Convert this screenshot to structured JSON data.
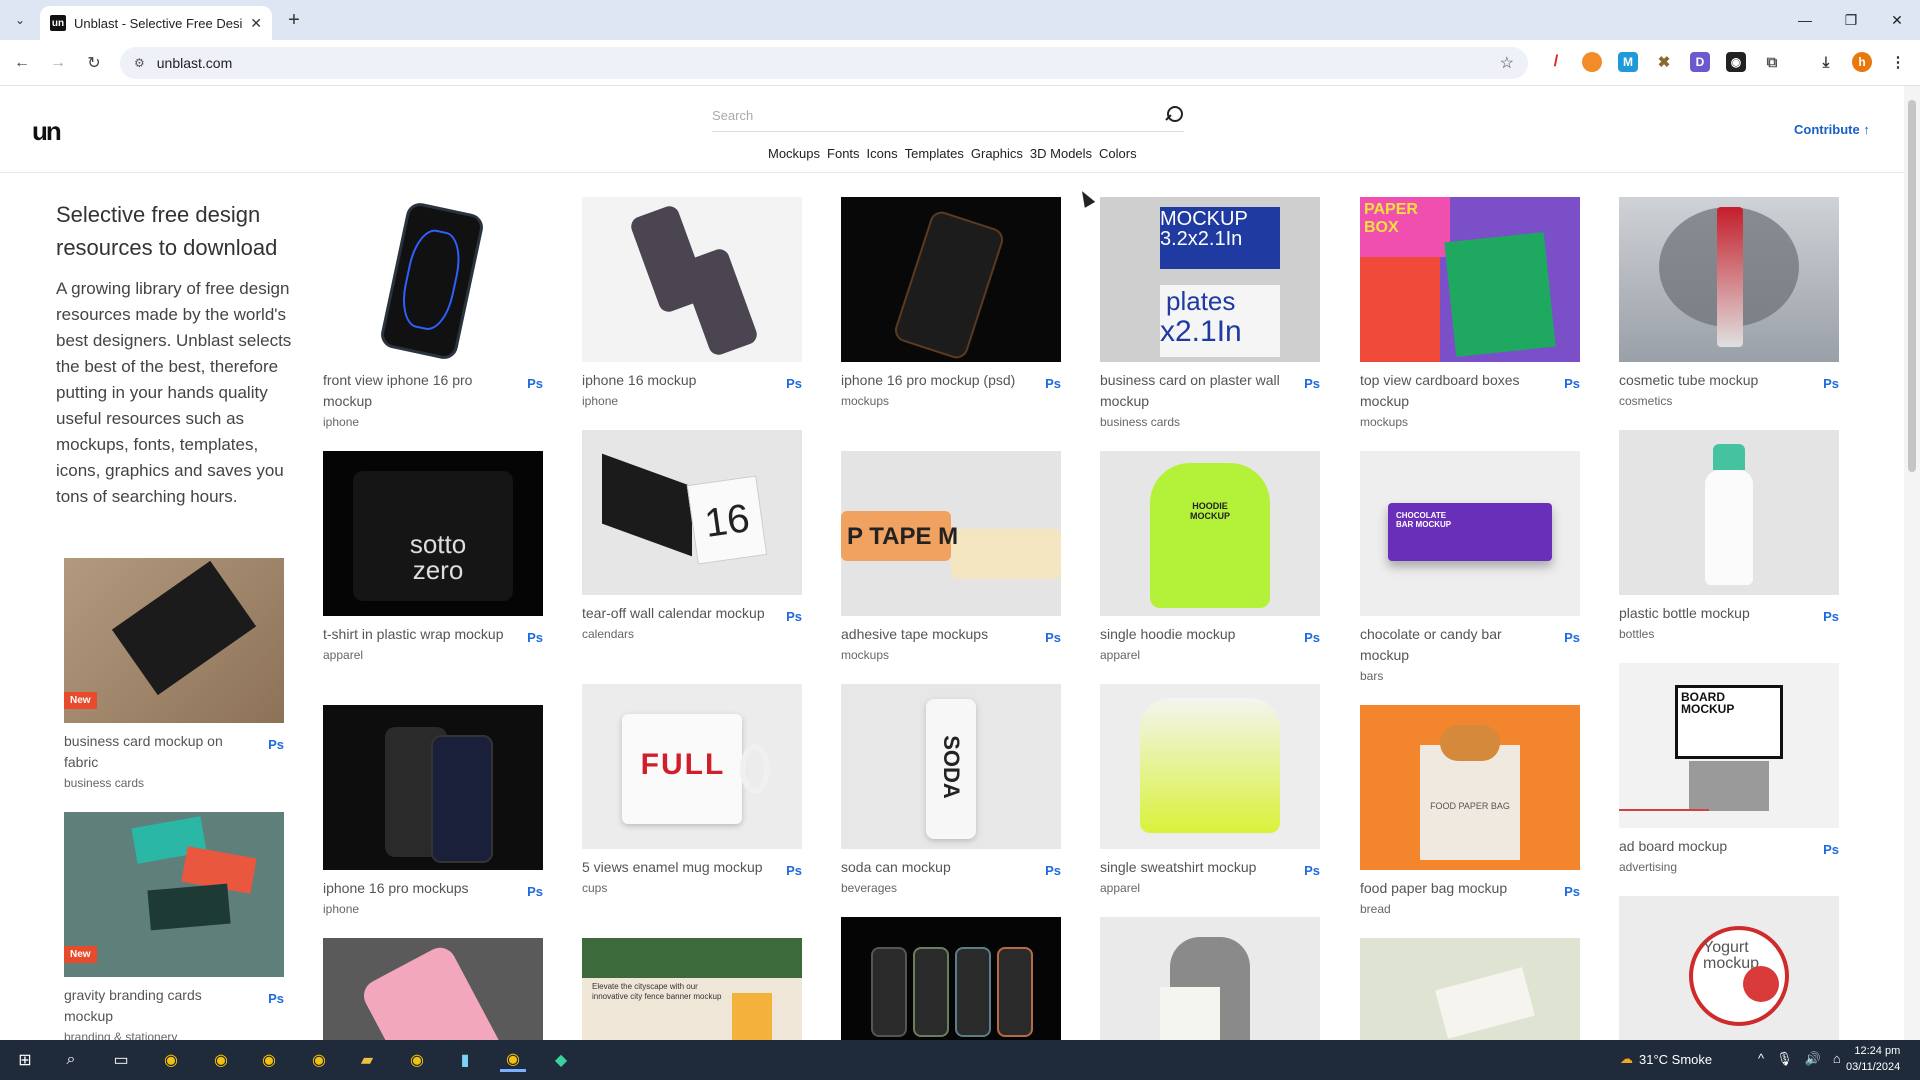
{
  "browser": {
    "tab_title": "Unblast - Selective Free Design",
    "url": "unblast.com"
  },
  "header": {
    "logo": "un",
    "search_placeholder": "Search",
    "nav": [
      "Mockups",
      "Fonts",
      "Icons",
      "Templates",
      "Graphics",
      "3D Models",
      "Colors"
    ],
    "contribute": "Contribute ↑"
  },
  "intro": {
    "title": "Selective free design resources to download",
    "text": "A growing library of free design resources made by the world's best designers. Unblast selects the best of the best, therefore putting in your hands quality useful resources such as mockups, fonts, templates, icons, graphics and saves you tons of searching hours."
  },
  "badge": {
    "new": "New",
    "ps": "Ps"
  },
  "cards": [
    {
      "title": "business card mockup on fabric",
      "category": "business cards",
      "new": true
    },
    {
      "title": "gravity branding cards mockup",
      "category": "branding & stationery",
      "new": true
    },
    {
      "title": "front view iphone 16 pro mockup",
      "category": "iphone"
    },
    {
      "title": "t-shirt in plastic wrap mockup",
      "category": "apparel"
    },
    {
      "title": "iphone 16 pro mockups",
      "category": "iphone"
    },
    {
      "title": "iphone 16 mockup",
      "category": "iphone"
    },
    {
      "title": "tear-off wall calendar mockup",
      "category": "calendars"
    },
    {
      "title": "5 views enamel mug mockup",
      "category": "cups"
    },
    {
      "title": "iphone 16 pro mockup (psd)",
      "category": "mockups"
    },
    {
      "title": "adhesive tape mockups",
      "category": "mockups"
    },
    {
      "title": "soda can mockup",
      "category": "beverages"
    },
    {
      "title": "business card on plaster wall mockup",
      "category": "business cards"
    },
    {
      "title": "single hoodie mockup",
      "category": "apparel"
    },
    {
      "title": "single sweatshirt mockup",
      "category": "apparel"
    },
    {
      "title": "top view cardboard boxes mockup",
      "category": "mockups"
    },
    {
      "title": "chocolate or candy bar mockup",
      "category": "bars"
    },
    {
      "title": "food paper bag mockup",
      "category": "bread"
    },
    {
      "title": "cosmetic tube mockup",
      "category": "cosmetics"
    },
    {
      "title": "plastic bottle mockup",
      "category": "bottles"
    },
    {
      "title": "ad board mockup",
      "category": "advertising"
    }
  ],
  "thumb_text": {
    "sotto": "sotto zero",
    "calendar_day": "16",
    "mug": "FULL",
    "soda": "SODA",
    "plaster_1": "MOCKUP",
    "plaster_2": "3.2x2.1In",
    "plaster_3": "plates",
    "plaster_4": "x2.1In",
    "paperbox": "PAPER BOX",
    "tape": "P TAPE M",
    "hoodie": "HOODIE MOCKUP",
    "choc": "CHOCOLATE BAR MOCKUP",
    "bag": "FOOD PAPER BAG",
    "board": "BOARD MOCKUP",
    "yogurt": "Yogurt mockup",
    "banner": "Elevate the cityscape with our innovative city fence banner mockup"
  },
  "taskbar": {
    "weather": "31°C  Smoke",
    "time": "12:24 pm",
    "date": "03/11/2024"
  },
  "colors": {
    "accent_blue": "#1e6be0",
    "new_badge": "#e84a2c",
    "taskbar": "#1f2a3a"
  }
}
